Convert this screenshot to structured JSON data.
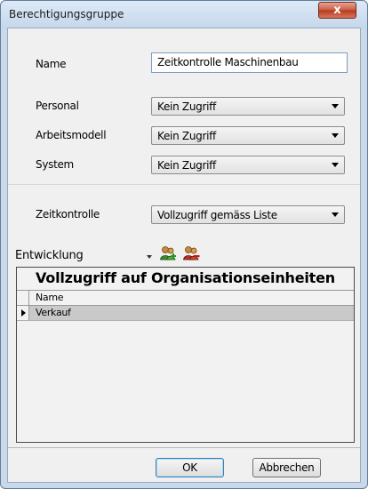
{
  "window": {
    "title": "Berechtigungsgruppe",
    "close_label": "x"
  },
  "form": {
    "name_label": "Name",
    "name_value": "Zeitkontrolle Maschinenbau",
    "personal_label": "Personal",
    "personal_value": "Kein Zugriff",
    "arbeitsmodell_label": "Arbeitsmodell",
    "arbeitsmodell_value": "Kein Zugriff",
    "system_label": "System",
    "system_value": "Kein Zugriff",
    "zeitkontrolle_label": "Zeitkontrolle",
    "zeitkontrolle_value": "Vollzugriff gemäss Liste"
  },
  "toolbar": {
    "combo_value": "Entwicklung",
    "add_icon": "add-users-icon",
    "remove_icon": "remove-users-icon"
  },
  "grid": {
    "caption": "Vollzugriff auf Organisationseinheiten",
    "column_header": "Name",
    "rows": [
      "Verkauf"
    ]
  },
  "buttons": {
    "ok": "OK",
    "cancel": "Abbrechen"
  }
}
